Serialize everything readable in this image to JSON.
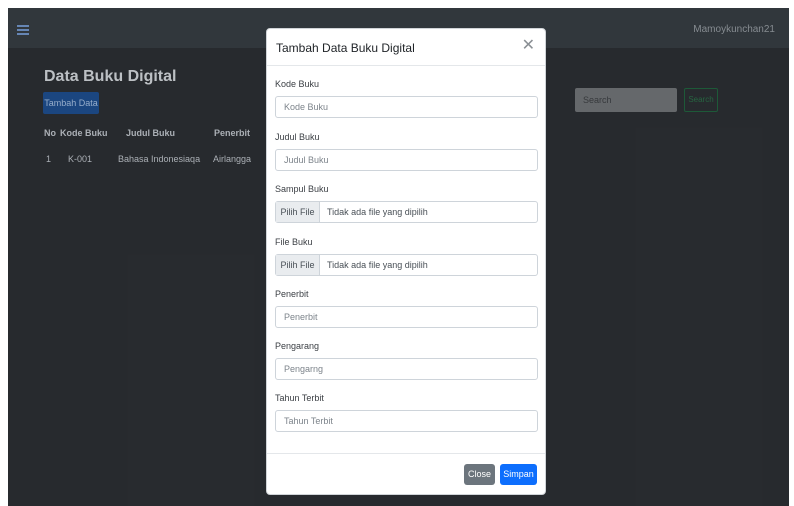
{
  "navbar": {
    "menu_icon": "hamburger-icon",
    "user": "Mamoykunchan21"
  },
  "page": {
    "title": "Data Buku Digital",
    "add_button": "Tambah Data"
  },
  "search": {
    "placeholder": "Search",
    "button": "Search"
  },
  "table": {
    "headers": [
      "No",
      "Kode Buku",
      "Judul Buku",
      "Penerbit"
    ],
    "rows": [
      [
        "1",
        "K-001",
        "Bahasa Indonesiaqa",
        "Airlangga"
      ]
    ]
  },
  "modal": {
    "title": "Tambah Data Buku Digital",
    "close_icon": "close-icon",
    "fields": {
      "kode_label": "Kode Buku",
      "kode_placeholder": "Kode Buku",
      "judul_label": "Judul Buku",
      "judul_placeholder": "Judul Buku",
      "sampul_label": "Sampul Buku",
      "file_label": "File Buku",
      "file_button": "Pilih File",
      "file_none": "Tidak ada file yang dipilih",
      "penerbit_label": "Penerbit",
      "penerbit_placeholder": "Penerbit",
      "pengarang_label": "Pengarang",
      "pengarang_placeholder": "Pengarng",
      "tahun_label": "Tahun Terbit",
      "tahun_placeholder": "Tahun Terbit"
    },
    "close_button": "Close",
    "save_button": "Simpan"
  },
  "colors": {
    "primary": "#0d6efd",
    "secondary": "#6c757d",
    "navbar": "#343a40"
  }
}
